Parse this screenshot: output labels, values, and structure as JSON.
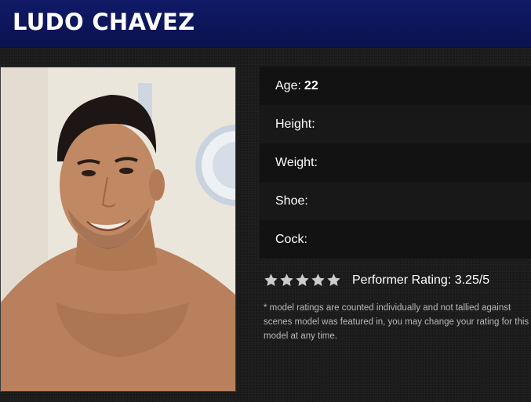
{
  "header": {
    "name": "LUDO CHAVEZ"
  },
  "photo": {
    "alt": "Ludo Chavez"
  },
  "stats": {
    "age_label": "Age:",
    "age_value": "22",
    "height_label": "Height:",
    "weight_label": "Weight:",
    "shoe_label": "Shoe:",
    "cock_label": "Cock:"
  },
  "rating": {
    "stars_total": 5,
    "star_color": "#cccccc",
    "text": "Performer Rating: 3.25/5",
    "note": "* model ratings are counted individually and not tallied against scenes model was featured in, you may change your rating for this model at any time."
  },
  "colors": {
    "header_bg": "#0d1559",
    "page_bg": "#1b1b1b",
    "row_dark": "#121212",
    "row_light": "#181818"
  }
}
